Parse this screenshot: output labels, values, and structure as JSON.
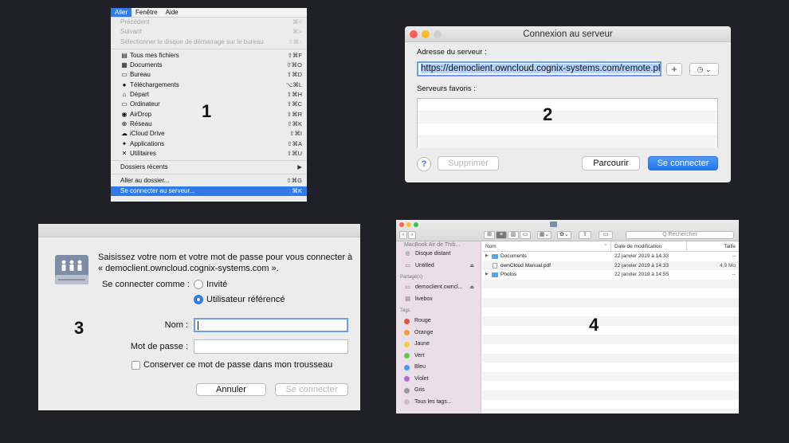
{
  "panel1": {
    "menubar": [
      "Aller",
      "Fenêtre",
      "Aide"
    ],
    "disabled_items": [
      {
        "label": "Précédent",
        "shortcut": "⌘<"
      },
      {
        "label": "Suivant",
        "shortcut": "⌘>"
      },
      {
        "label": "Sélectionner le disque de démarrage sur le bureau",
        "shortcut": "⇧⌘↑"
      }
    ],
    "places": [
      {
        "icon": "all-files-icon",
        "glyph": "▤",
        "label": "Tous mes fichiers",
        "shortcut": "⇧⌘F"
      },
      {
        "icon": "documents-icon",
        "glyph": "▦",
        "label": "Documents",
        "shortcut": "⇧⌘O"
      },
      {
        "icon": "desktop-icon",
        "glyph": "▭",
        "label": "Bureau",
        "shortcut": "⇧⌘D"
      },
      {
        "icon": "downloads-icon",
        "glyph": "●",
        "label": "Téléchargements",
        "shortcut": "⌥⌘L"
      },
      {
        "icon": "home-icon",
        "glyph": "⌂",
        "label": "Départ",
        "shortcut": "⇧⌘H"
      },
      {
        "icon": "computer-icon",
        "glyph": "▭",
        "label": "Ordinateur",
        "shortcut": "⇧⌘C"
      },
      {
        "icon": "airdrop-icon",
        "glyph": "◉",
        "label": "AirDrop",
        "shortcut": "⇧⌘R"
      },
      {
        "icon": "network-icon",
        "glyph": "⊕",
        "label": "Réseau",
        "shortcut": "⇧⌘K"
      },
      {
        "icon": "icloud-icon",
        "glyph": "☁",
        "label": "iCloud Drive",
        "shortcut": "⇧⌘I"
      },
      {
        "icon": "applications-icon",
        "glyph": "✦",
        "label": "Applications",
        "shortcut": "⇧⌘A"
      },
      {
        "icon": "utilities-icon",
        "glyph": "✕",
        "label": "Utilitaires",
        "shortcut": "⇧⌘U"
      }
    ],
    "recent": {
      "label": "Dossiers récents",
      "arrow": "▶"
    },
    "goto": {
      "label": "Aller au dossier...",
      "shortcut": "⇧⌘G"
    },
    "connect": {
      "label": "Se connecter au serveur...",
      "shortcut": "⌘K"
    },
    "step": "1"
  },
  "panel2": {
    "title": "Connexion au serveur",
    "address_label": "Adresse du serveur :",
    "address_value": "https://democlient.owncloud.cognix-systems.com/remote.php/webdav",
    "plus": "+",
    "history": "◷ ⌄",
    "favorites_label": "Serveurs favoris :",
    "help": "?",
    "remove": "Supprimer",
    "browse": "Parcourir",
    "connect": "Se connecter",
    "step": "2"
  },
  "panel3": {
    "message": "Saisissez votre nom et votre mot de passe pour vous connecter à « democlient.owncloud.cognix-systems.com ».",
    "connect_as": "Se connecter comme :",
    "guest": "Invité",
    "registered": "Utilisateur référencé",
    "name_label": "Nom :",
    "name_value": "",
    "password_label": "Mot de passe :",
    "password_value": "",
    "remember": "Conserver ce mot de passe dans mon trousseau",
    "cancel": "Annuler",
    "connect": "Se connecter",
    "step": "3"
  },
  "panel4": {
    "search_placeholder": "Q Rechercher",
    "sidebar": {
      "cut_item": "MacBook Air de Thib...",
      "devices": [
        {
          "icon": "remote-disc-icon",
          "glyph": "◎",
          "label": "Disque distant"
        },
        {
          "icon": "drive-icon",
          "glyph": "▭",
          "label": "Untitled",
          "eject": "⏏"
        }
      ],
      "shared_header": "Partagé(s)",
      "shared": [
        {
          "icon": "server-icon",
          "glyph": "▭",
          "label": "democlient.owncl...",
          "eject": "⏏"
        },
        {
          "icon": "livebox-icon",
          "glyph": "▤",
          "label": "livebox"
        }
      ],
      "tags_header": "Tags",
      "tags": [
        {
          "label": "Rouge",
          "color": "#f04a45"
        },
        {
          "label": "Orange",
          "color": "#f59a32"
        },
        {
          "label": "Jaune",
          "color": "#f5cd3a"
        },
        {
          "label": "Vert",
          "color": "#5fc94e"
        },
        {
          "label": "Bleu",
          "color": "#3f9cf1"
        },
        {
          "label": "Violet",
          "color": "#b46ad6"
        },
        {
          "label": "Gris",
          "color": "#9a9a9a"
        }
      ],
      "all_tags": "Tous les tags..."
    },
    "columns": {
      "name": "Nom",
      "date": "Date de modification",
      "size": "Taille"
    },
    "files": [
      {
        "type": "folder",
        "name": "Documents",
        "date": "22 janvier 2019 à 14:33",
        "size": "--"
      },
      {
        "type": "pdf",
        "name": "ownCloud Manual.pdf",
        "date": "22 janvier 2019 à 14:33",
        "size": "4,9 Mo"
      },
      {
        "type": "folder",
        "name": "Photos",
        "date": "22 janvier 2019 à 14:55",
        "size": "--"
      }
    ],
    "step": "4"
  }
}
